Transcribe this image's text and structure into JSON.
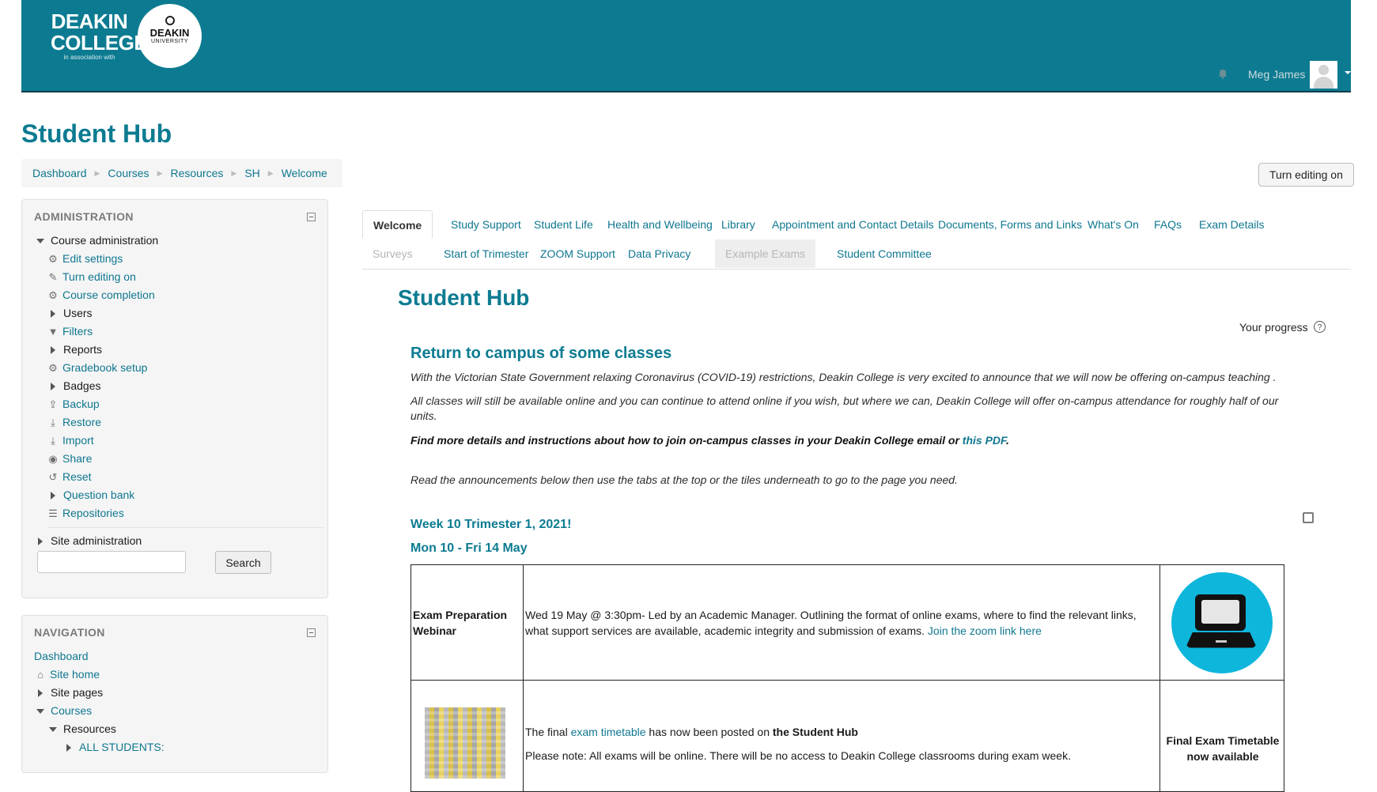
{
  "header": {
    "logo_college_line1": "DEAKIN",
    "logo_college_line2": "COLLEGE",
    "logo_tagline": "in association with",
    "logo_uni_line1": "DEAKIN",
    "logo_uni_line2": "UNIVERSITY",
    "user_name": "Meg James",
    "icons": [
      "bell-icon",
      "avatar",
      "chevron-down-icon"
    ]
  },
  "page": {
    "title": "Student Hub",
    "breadcrumb": [
      "Dashboard",
      "Courses",
      "Resources",
      "SH",
      "Welcome"
    ],
    "edit_button": "Turn editing on"
  },
  "admin_block": {
    "title": "ADMINISTRATION",
    "course_admin": "Course administration",
    "items": [
      {
        "label": "Edit settings",
        "icon": "gear-icon",
        "link": true
      },
      {
        "label": "Turn editing on",
        "icon": "pencil-icon",
        "link": true
      },
      {
        "label": "Course completion",
        "icon": "gear-icon",
        "link": true
      },
      {
        "label": "Users",
        "icon": "expand-arrow",
        "link": false
      },
      {
        "label": "Filters",
        "icon": "filter-icon",
        "link": true
      },
      {
        "label": "Reports",
        "icon": "expand-arrow",
        "link": false
      },
      {
        "label": "Gradebook setup",
        "icon": "gear-icon",
        "link": true
      },
      {
        "label": "Badges",
        "icon": "expand-arrow",
        "link": false
      },
      {
        "label": "Backup",
        "icon": "upload-icon",
        "link": true
      },
      {
        "label": "Restore",
        "icon": "download-icon",
        "link": true
      },
      {
        "label": "Import",
        "icon": "download-icon",
        "link": true
      },
      {
        "label": "Share",
        "icon": "globe-icon",
        "link": true
      },
      {
        "label": "Reset",
        "icon": "reset-icon",
        "link": true
      },
      {
        "label": "Question bank",
        "icon": "expand-arrow",
        "link": true
      },
      {
        "label": "Repositories",
        "icon": "database-icon",
        "link": true
      }
    ],
    "site_admin": "Site administration",
    "search_button": "Search"
  },
  "nav_block": {
    "title": "NAVIGATION",
    "dashboard": "Dashboard",
    "site_home": "Site home",
    "site_pages": "Site pages",
    "courses": "Courses",
    "resources": "Resources",
    "all_students": "ALL STUDENTS:"
  },
  "tabs": {
    "row1": [
      "Welcome",
      "Study Support",
      "Student Life",
      "Health and Wellbeing",
      "Library",
      "Appointment and Contact Details",
      "Documents, Forms and Links",
      "What's On",
      "FAQs",
      "Exam Details"
    ],
    "row2": [
      "Surveys",
      "Start of Trimester",
      "ZOOM Support",
      "Data Privacy",
      "Example Exams",
      "Student Committee"
    ]
  },
  "course": {
    "title": "Student Hub",
    "progress_label": "Your progress",
    "progress_help": "?",
    "announce_heading": "Return to campus of some classes",
    "p1": "With the Victorian State Government relaxing Coronavirus (COVID-19) restrictions, Deakin College is very excited to announce that we will now be offering on-campus teaching .",
    "p2": "All classes will still be available online and you can continue to attend online if you wish, but where we can, Deakin College will offer on-campus attendance for roughly half of our units.",
    "p3_text": "Find more details and instructions about how to join on-campus classes in your Deakin College email or ",
    "p3_link": "this PDF",
    "p3_end": ".",
    "p4": "Read the announcements below then use the tabs at the top or the tiles underneath to go to the page you need.",
    "week_heading": "Week 10 Trimester 1, 2021!",
    "date_heading": "Mon 10 -  Fri 14 May"
  },
  "table": {
    "row1": {
      "label": "Exam Preparation Webinar",
      "body": "Wed 19 May @ 3:30pm- Led by an Academic Manager. Outlining the format of online exams, where to find the relevant links, what support services are available, academic integrity and submission of exams. ",
      "link": "Join the zoom link here"
    },
    "row2": {
      "body_a": "The final ",
      "link": "exam timetable",
      "body_b": " has now been posted on ",
      "body_bold": "the Student Hub",
      "note": "Please note: All exams will be online. There will be no access to Deakin College classrooms during exam week.",
      "label": "Final Exam Timetable now available"
    }
  }
}
